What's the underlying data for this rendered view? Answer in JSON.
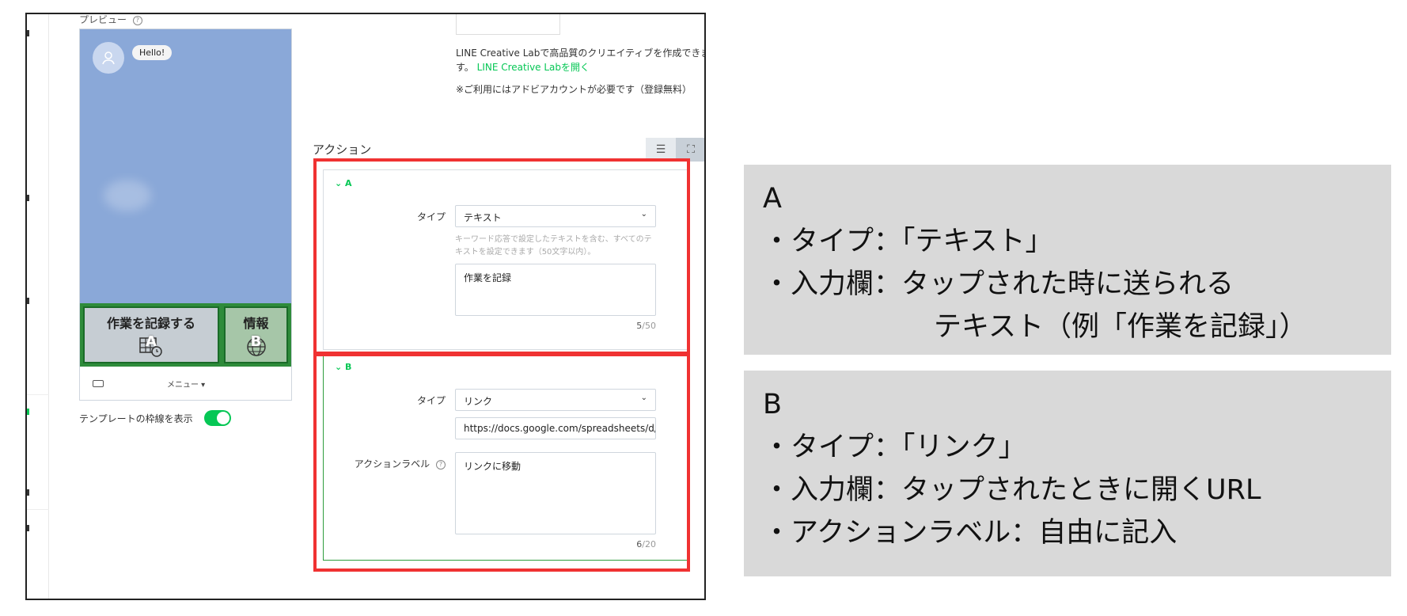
{
  "preview": {
    "label": "プレビュー",
    "bubble": "Hello!",
    "rich_menu": {
      "cell_a": {
        "title": "作業を記録する",
        "letter": "A"
      },
      "cell_b": {
        "title": "情報",
        "letter": "B"
      }
    },
    "menu_toggle": "メニュー ▾",
    "template_border_label": "テンプレートの枠線を表示"
  },
  "creative": {
    "text": "LINE Creative Labで高品質のクリエイティブを作成できます。",
    "link": "LINE Creative Labを開く",
    "note": "※ご利用にはアドビアカウントが必要です（登録無料）"
  },
  "action": {
    "title": "アクション",
    "view_icons": [
      "list-icon",
      "expand-icon"
    ],
    "a": {
      "head": "A",
      "type_label": "タイプ",
      "type_value": "テキスト",
      "hint": "キーワード応答で設定したテキストを含む、すべてのテキストを設定できます（50文字以内）。",
      "text_value": "作業を記録",
      "count": "5",
      "max": "/50"
    },
    "b": {
      "head": "B",
      "type_label": "タイプ",
      "type_value": "リンク",
      "url_value": "https://docs.google.com/spreadsheets/d/",
      "action_label_label": "アクションラベル",
      "action_label_value": "リンクに移動",
      "count": "6",
      "max": "/20"
    }
  },
  "notes": {
    "a": {
      "title": "A",
      "line1": "・タイプ：「テキスト」",
      "line2": "・入力欄：タップされた時に送られる",
      "line3": "テキスト（例「作業を記録」）"
    },
    "b": {
      "title": "B",
      "line1": "・タイプ：「リンク」",
      "line2": "・入力欄：タップされたときに開くURL",
      "line3": "・アクションラベル：自由に記入"
    }
  },
  "colors": {
    "accent": "#06c755",
    "highlight": "#f03232",
    "preview_bg": "#8aa8d8",
    "note_bg": "#d9d9d9"
  }
}
